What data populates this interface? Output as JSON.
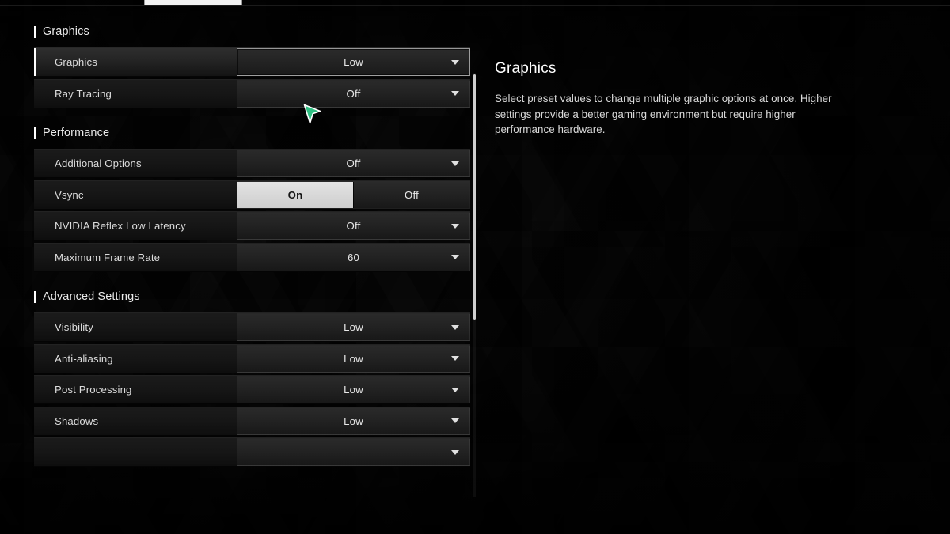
{
  "topbar": {
    "active_tab_present": true
  },
  "scrollbar": {
    "visible": true
  },
  "cursor": {
    "color": "#2fbf82",
    "outline": "#ffffff"
  },
  "settings": {
    "sections": [
      {
        "title": "Graphics",
        "rows": [
          {
            "label": "Graphics",
            "type": "dropdown",
            "value": "Low",
            "selected": true
          },
          {
            "label": "Ray Tracing",
            "type": "dropdown",
            "value": "Off",
            "selected": false
          }
        ]
      },
      {
        "title": "Performance",
        "rows": [
          {
            "label": "Additional Options",
            "type": "dropdown",
            "value": "Off",
            "selected": false
          },
          {
            "label": "Vsync",
            "type": "segmented",
            "options": [
              "On",
              "Off"
            ],
            "value": "On",
            "selected": false
          },
          {
            "label": "NVIDIA Reflex Low Latency",
            "type": "dropdown",
            "value": "Off",
            "selected": false
          },
          {
            "label": "Maximum Frame Rate",
            "type": "dropdown",
            "value": "60",
            "selected": false
          }
        ]
      },
      {
        "title": "Advanced Settings",
        "rows": [
          {
            "label": "Visibility",
            "type": "dropdown",
            "value": "Low",
            "selected": false
          },
          {
            "label": "Anti-aliasing",
            "type": "dropdown",
            "value": "Low",
            "selected": false
          },
          {
            "label": "Post Processing",
            "type": "dropdown",
            "value": "Low",
            "selected": false
          },
          {
            "label": "Shadows",
            "type": "dropdown",
            "value": "Low",
            "selected": false
          },
          {
            "label": "",
            "type": "dropdown",
            "value": "",
            "selected": false
          }
        ]
      }
    ]
  },
  "description": {
    "title": "Graphics",
    "body": "Select preset values to change multiple graphic options at once. Higher settings provide a better gaming environment but require higher performance hardware."
  },
  "colors": {
    "accent_selected": "#ffffff",
    "toggle_active_bg": "#d7d7d7",
    "cursor_green": "#2fbf82",
    "panel_bg": "#1a1a1a",
    "text_primary": "#e8e8e8"
  }
}
